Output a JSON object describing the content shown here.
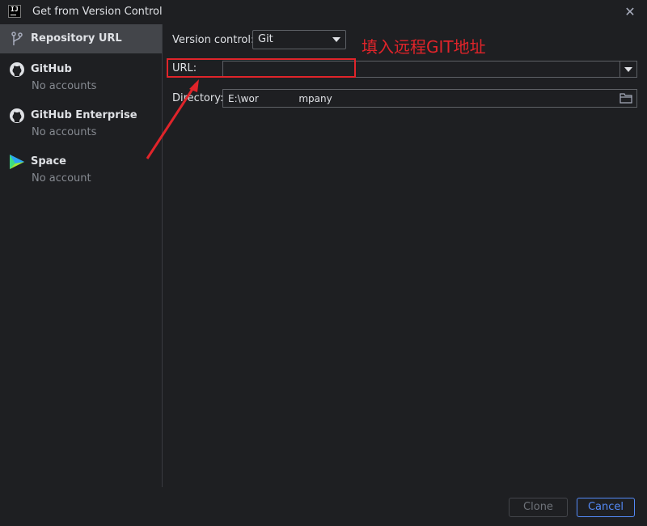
{
  "window": {
    "title": "Get from Version Control",
    "app_icon_text": "IJ"
  },
  "sidebar": {
    "items": [
      {
        "label": "Repository URL",
        "sub": "",
        "icon": "vcs-branch-icon",
        "selected": true
      },
      {
        "label": "GitHub",
        "sub": "No accounts",
        "icon": "github-icon",
        "selected": false
      },
      {
        "label": "GitHub Enterprise",
        "sub": "No accounts",
        "icon": "github-icon",
        "selected": false
      },
      {
        "label": "Space",
        "sub": "No account",
        "icon": "space-icon",
        "selected": false
      }
    ]
  },
  "form": {
    "version_control_label": "Version control:",
    "version_control_value": "Git",
    "url_label": "URL:",
    "url_value": "",
    "directory_label": "Directory:",
    "directory_value": "E:\\wor             mpany"
  },
  "annotation": {
    "text": "填入远程GIT地址",
    "color": "#e0242a"
  },
  "buttons": {
    "clone": "Clone",
    "cancel": "Cancel"
  },
  "colors": {
    "accent": "#548af7",
    "selected_bg": "#43454a",
    "background": "#1e1f22"
  }
}
